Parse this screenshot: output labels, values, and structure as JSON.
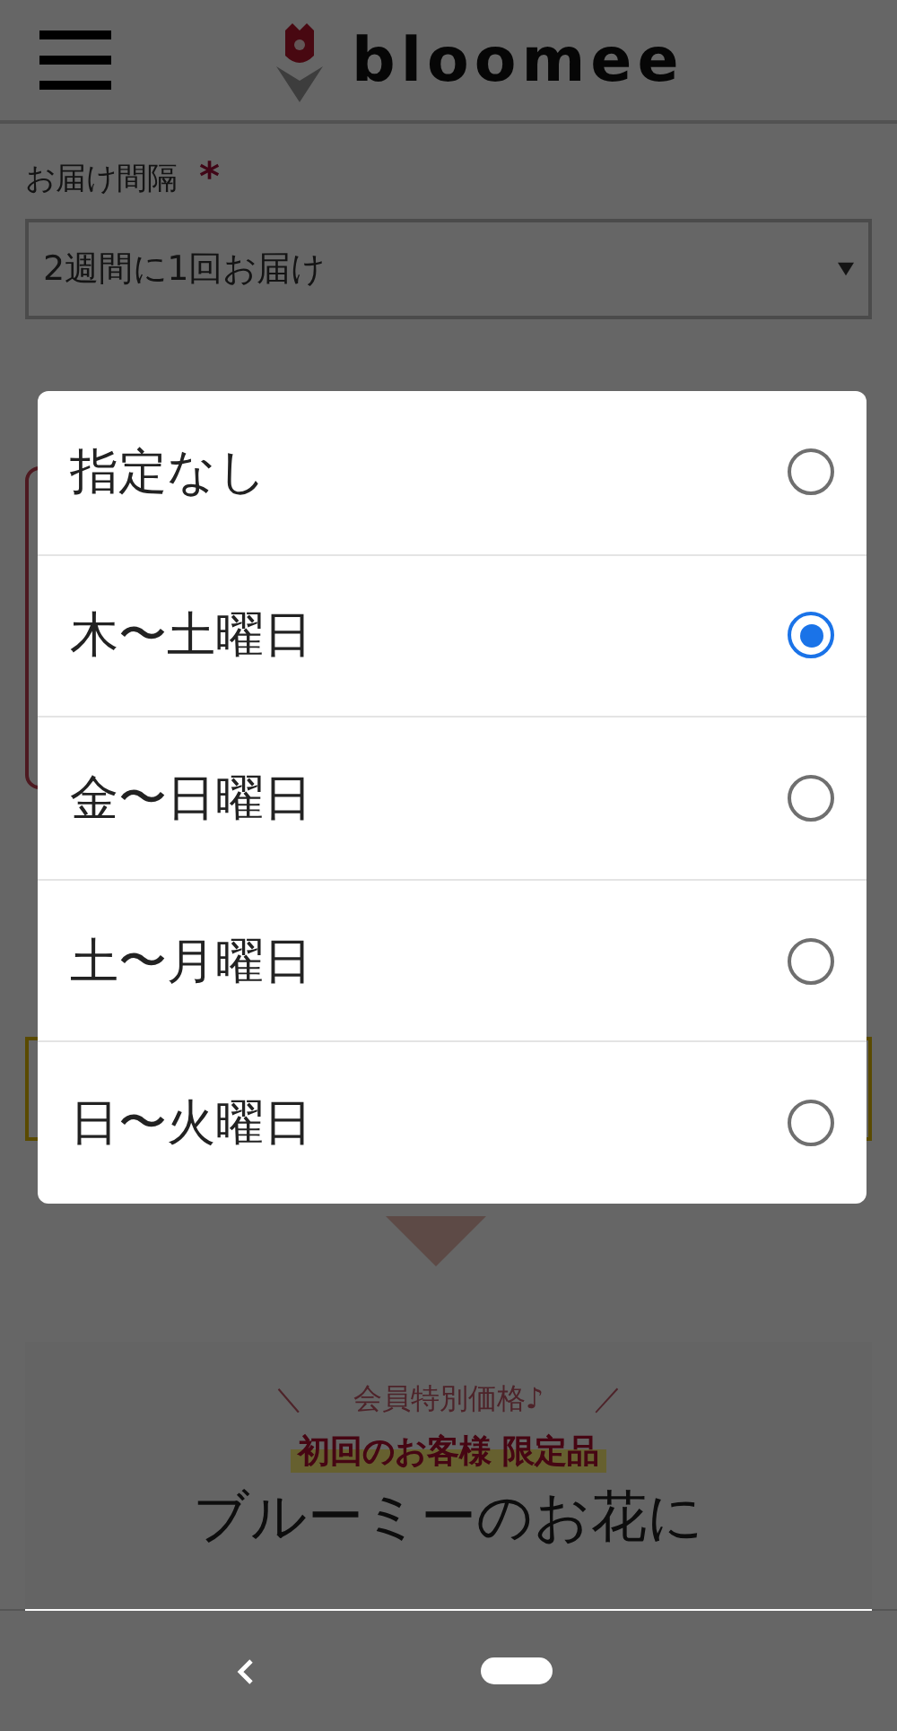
{
  "header": {
    "logo_text": "bloomee"
  },
  "form": {
    "interval_label": "お届け間隔",
    "required_mark": "*",
    "interval_value": "2週間に1回お届け"
  },
  "dialog": {
    "options": [
      {
        "label": "指定なし",
        "selected": false
      },
      {
        "label": "木〜土曜日",
        "selected": true
      },
      {
        "label": "金〜日曜日",
        "selected": false
      },
      {
        "label": "土〜月曜日",
        "selected": false
      },
      {
        "label": "日〜火曜日",
        "selected": false
      }
    ]
  },
  "promo": {
    "mark_left": "＼",
    "tagline": "会員特別価格♪",
    "mark_right": "／",
    "badge": "初回のお客様 限定品",
    "headline": "ブルーミーのお花に"
  }
}
